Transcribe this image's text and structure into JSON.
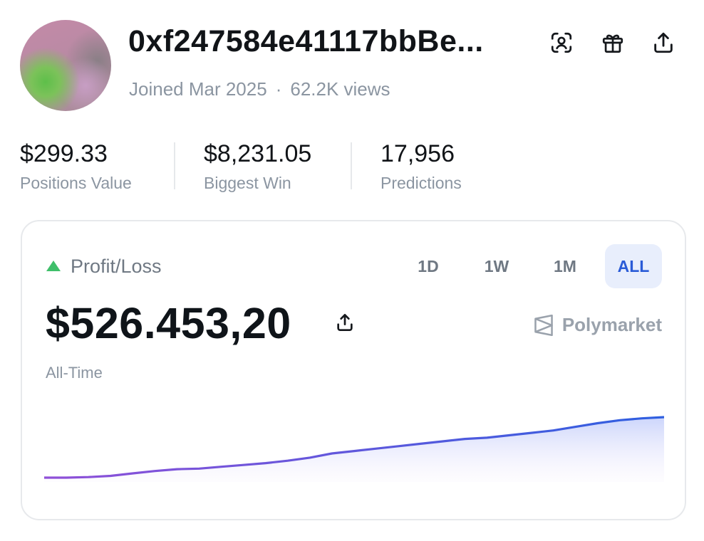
{
  "profile": {
    "title": "0xf247584e41117bbBe...",
    "joined": "Joined Mar 2025",
    "separator": "·",
    "views": "62.2K views"
  },
  "header_icons": [
    "scan-face-icon",
    "gift-icon",
    "share-icon"
  ],
  "stats": [
    {
      "value": "$299.33",
      "label": "Positions Value"
    },
    {
      "value": "$8,231.05",
      "label": "Biggest Win"
    },
    {
      "value": "17,956",
      "label": "Predictions"
    }
  ],
  "card": {
    "label": "Profit/Loss",
    "trend": "up",
    "ranges": [
      "1D",
      "1W",
      "1M",
      "ALL"
    ],
    "active_range": "ALL",
    "value": "$526.453,20",
    "period": "All-Time",
    "brand": "Polymarket"
  },
  "colors": {
    "up": "#3fbf6a",
    "accent": "#2a5bd7",
    "line_start": "#9050d8",
    "line_end": "#2e5fe0"
  },
  "chart_data": {
    "type": "area",
    "x": [
      0,
      1,
      2,
      3,
      4,
      5,
      6,
      7,
      8,
      9,
      10,
      11,
      12,
      13,
      14,
      15,
      16,
      17,
      18,
      19,
      20,
      21,
      22,
      23,
      24,
      25,
      26,
      27,
      28
    ],
    "values": [
      0.0,
      0.0,
      0.01,
      0.03,
      0.07,
      0.11,
      0.14,
      0.15,
      0.18,
      0.21,
      0.24,
      0.28,
      0.33,
      0.4,
      0.44,
      0.48,
      0.52,
      0.56,
      0.6,
      0.64,
      0.66,
      0.7,
      0.74,
      0.78,
      0.84,
      0.9,
      0.95,
      0.98,
      1.0
    ],
    "ylim": [
      0,
      1
    ],
    "grid": false
  }
}
